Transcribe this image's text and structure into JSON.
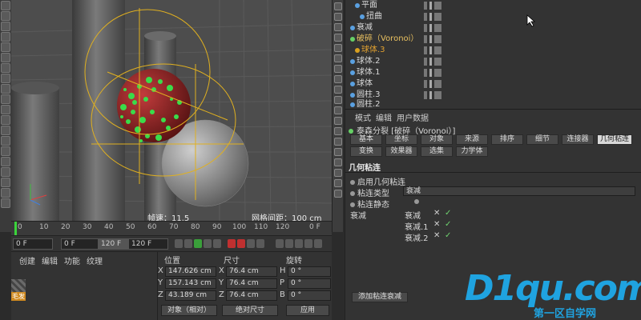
{
  "viewport": {
    "fps_label": "帧速：11.5",
    "grid_spacing_label": "网格间距：100 cm"
  },
  "timeline": {
    "ticks": [
      "0",
      "10",
      "20",
      "30",
      "40",
      "50",
      "60",
      "70",
      "80",
      "90",
      "100",
      "110",
      "120"
    ],
    "end_label": "0 F"
  },
  "transport": {
    "current_frame": "0 F",
    "min_frame": "0 F",
    "max_frame": "120 F",
    "end_frame": "120 F"
  },
  "material_panel": {
    "menu": [
      "创建",
      "编辑",
      "功能",
      "纹理"
    ],
    "material_name": "毛发"
  },
  "coordinates": {
    "headers": {
      "position": "位置",
      "size": "尺寸",
      "rotation": "旋转"
    },
    "rows": [
      {
        "axis": "X",
        "pos": "147.626 cm",
        "size_axis": "X",
        "size": "76.4 cm",
        "rot_axis": "H",
        "rot": "0 °"
      },
      {
        "axis": "Y",
        "pos": "157.143 cm",
        "size_axis": "Y",
        "size": "76.4 cm",
        "rot_axis": "P",
        "rot": "0 °"
      },
      {
        "axis": "Z",
        "pos": "43.189 cm",
        "size_axis": "Z",
        "size": "76.4 cm",
        "rot_axis": "B",
        "rot": "0 °"
      }
    ],
    "mode_select": "对象（相对）",
    "size_select": "绝对尺寸",
    "apply_button": "应用"
  },
  "object_manager": {
    "items": [
      {
        "label": "平面",
        "color": "#5aa0e0"
      },
      {
        "label": "扭曲",
        "color": "#5aa0e0"
      },
      {
        "label": "衰减",
        "color": "#5aa0e0"
      },
      {
        "label": "破碎（Voronoi）",
        "color": "#66d066"
      },
      {
        "label": "球体.3",
        "color": "#d8a020"
      },
      {
        "label": "球体.2",
        "color": "#5aa0e0"
      },
      {
        "label": "球体.1",
        "color": "#5aa0e0"
      },
      {
        "label": "球体",
        "color": "#5aa0e0"
      },
      {
        "label": "圆柱.3",
        "color": "#5aa0e0"
      },
      {
        "label": "圆柱.2",
        "color": "#5aa0e0"
      }
    ]
  },
  "attribute_manager": {
    "menu": [
      "模式",
      "编辑",
      "用户数据"
    ],
    "object_title": "泰森分裂 [破碎（Voronoi）]",
    "tabs_row1": [
      "基本",
      "坐标",
      "对象",
      "来源",
      "排序",
      "细节",
      "连接器",
      "几何粘连"
    ],
    "tabs_row2": [
      "变换",
      "效果器",
      "选集",
      "力学体"
    ],
    "active_tab": "几何粘连",
    "section_title": "几何粘连",
    "props": {
      "enable": "启用几何粘连",
      "type_label": "粘连类型",
      "type_value": "衰减",
      "static_label": "粘连静态",
      "falloff_label": "衰减"
    },
    "falloff_items": [
      "衰减",
      "衰减.1",
      "衰减.2"
    ],
    "add_button": "添加粘连衰减"
  },
  "watermark": {
    "brand": "D1qu.com",
    "tagline": "第一区自学网"
  }
}
